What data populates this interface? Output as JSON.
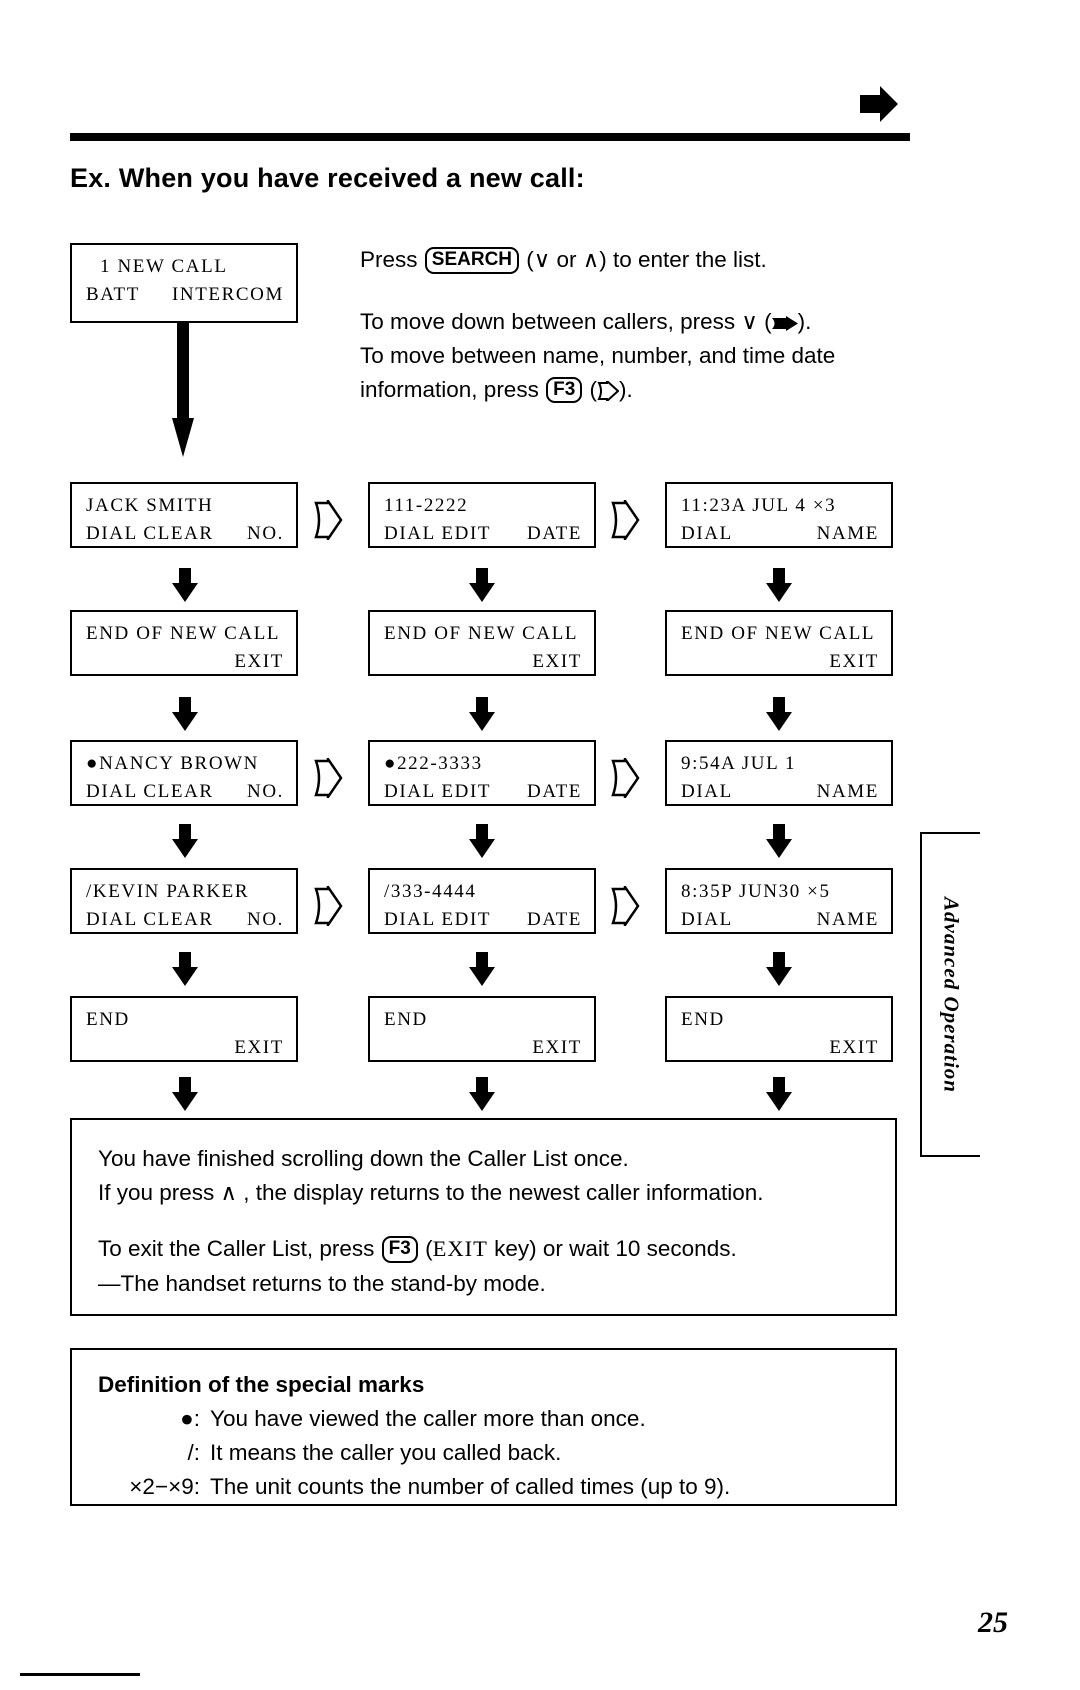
{
  "header": {
    "section_title": "Ex. When you have received a new call:",
    "corner_icon": "right-arrow-marker"
  },
  "intro": {
    "line1_pre": "Press",
    "search_key": "SEARCH",
    "line1_post": "(∨ or ∧) to enter the list.",
    "line2_pre": "To move down between callers, press ∨ (",
    "line2_icon": "down-arrow-glyph",
    "line2_post": ").",
    "line3": "To move between name, number, and time date",
    "line4_pre": "information, press",
    "f3_key": "F3",
    "line4_post": "(",
    "line4_icon": "right-arrow-glyph",
    "line4_end": ")."
  },
  "initial_display": {
    "line1": "1 NEW CALL",
    "line2_left": "BATT",
    "line2_right": "INTERCOM"
  },
  "columns": [
    {
      "name": "name-column"
    },
    {
      "name": "number-column"
    },
    {
      "name": "time-date-column"
    }
  ],
  "displays": [
    [
      {
        "line1": "JACK SMITH",
        "line2_left": "DIAL CLEAR",
        "line2_right": "NO."
      },
      {
        "line1": "111-2222",
        "line2_left": "DIAL EDIT",
        "line2_right": "DATE"
      },
      {
        "line1": "11:23A JUL 4 ×3",
        "line2_left": "DIAL",
        "line2_right": "NAME"
      }
    ],
    [
      {
        "line1": "END OF NEW CALL",
        "line2_left": "",
        "line2_right": "EXIT"
      },
      {
        "line1": "END OF NEW CALL",
        "line2_left": "",
        "line2_right": "EXIT"
      },
      {
        "line1": "END OF NEW CALL",
        "line2_left": "",
        "line2_right": "EXIT"
      }
    ],
    [
      {
        "line1": "●NANCY BROWN",
        "line2_left": "DIAL CLEAR",
        "line2_right": "NO."
      },
      {
        "line1": "●222-3333",
        "line2_left": "DIAL EDIT",
        "line2_right": "DATE"
      },
      {
        "line1": "9:54A JUL 1",
        "line2_left": "DIAL",
        "line2_right": "NAME"
      }
    ],
    [
      {
        "line1": "/KEVIN PARKER",
        "line2_left": "DIAL CLEAR",
        "line2_right": "NO."
      },
      {
        "line1": "/333-4444",
        "line2_left": "DIAL EDIT",
        "line2_right": "DATE"
      },
      {
        "line1": "8:35P JUN30 ×5",
        "line2_left": "DIAL",
        "line2_right": "NAME"
      }
    ],
    [
      {
        "line1": "END",
        "line2_left": "",
        "line2_right": "EXIT"
      },
      {
        "line1": "END",
        "line2_left": "",
        "line2_right": "EXIT"
      },
      {
        "line1": "END",
        "line2_left": "",
        "line2_right": "EXIT"
      }
    ]
  ],
  "note_scroll": {
    "line1": "You have finished scrolling down the Caller List once.",
    "line2": "If you press ∧ , the display returns to the newest caller information.",
    "line3_pre": "To exit the Caller List, press",
    "f3_key": "F3",
    "line3_mid": "(",
    "line3_key": "EXIT",
    "line3_post": "key) or wait 10 seconds.",
    "line4": "—The handset returns to the stand-by mode."
  },
  "note_marks": {
    "title": "Definition of the special marks",
    "rows": [
      {
        "key": "●:",
        "text": "You have viewed the caller more than once."
      },
      {
        "key": "/:",
        "text": "It means the caller you called back."
      },
      {
        "key": "×2−×9:",
        "text": "The unit counts the number of called times (up to 9)."
      }
    ]
  },
  "side_tab": {
    "label": "Advanced Operation"
  },
  "footer": {
    "page_number": "25"
  }
}
